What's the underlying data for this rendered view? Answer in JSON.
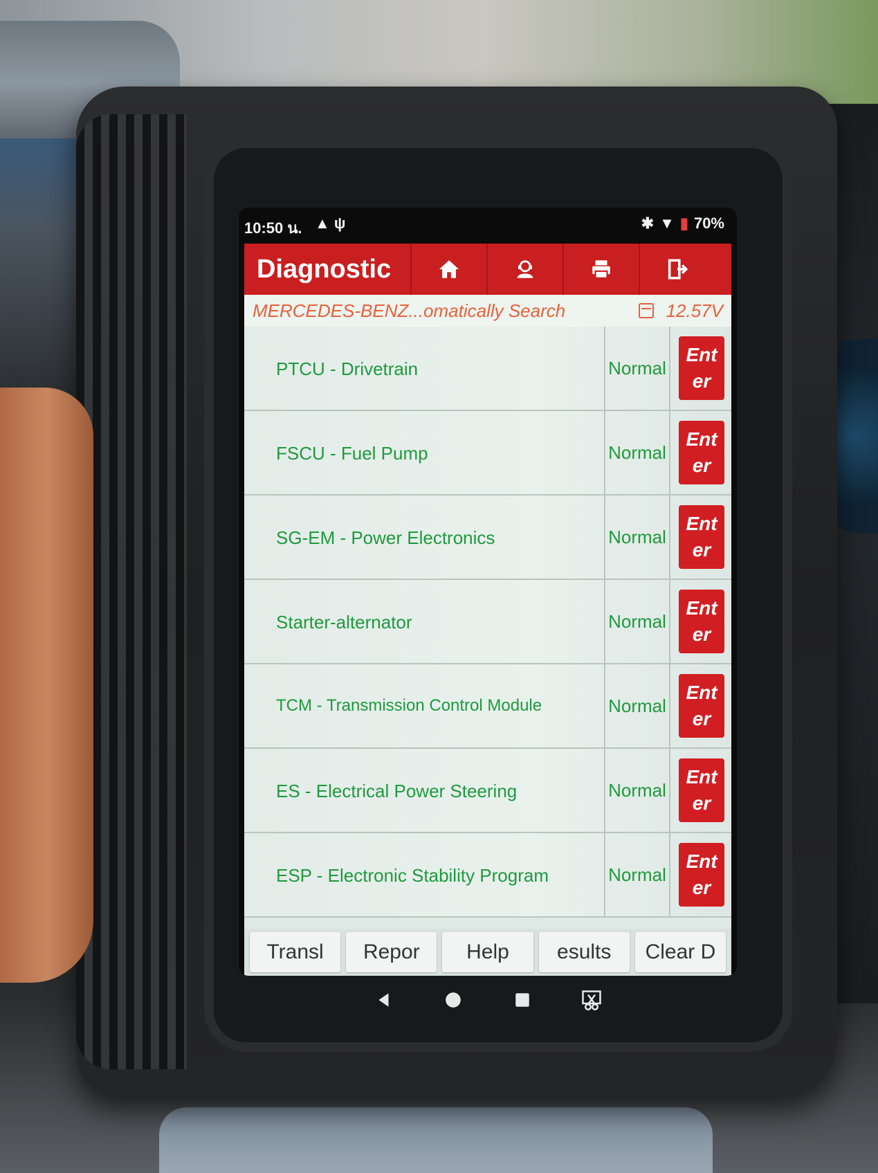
{
  "status_bar": {
    "time": "10:50 น.",
    "battery": "70%"
  },
  "app_bar": {
    "title": "Diagnostic",
    "buttons": [
      {
        "icon": "home-icon"
      },
      {
        "icon": "user-support-icon"
      },
      {
        "icon": "print-icon"
      },
      {
        "icon": "exit-icon"
      }
    ]
  },
  "sub_header": {
    "path": "MERCEDES-BENZ...omatically Search",
    "voltage": "12.57V"
  },
  "modules": [
    {
      "name": "PTCU - Drivetrain",
      "status": "Normal",
      "action": "Enter"
    },
    {
      "name": "FSCU - Fuel Pump",
      "status": "Normal",
      "action": "Enter"
    },
    {
      "name": "SG-EM - Power Electronics",
      "status": "Normal",
      "action": "Enter"
    },
    {
      "name": "Starter-alternator",
      "status": "Normal",
      "action": "Enter"
    },
    {
      "name": "TCM - Transmission Control Module",
      "status": "Normal",
      "action": "Enter"
    },
    {
      "name": "ES - Electrical Power Steering",
      "status": "Normal",
      "action": "Enter"
    },
    {
      "name": "ESP - Electronic Stability Program",
      "status": "Normal",
      "action": "Enter"
    }
  ],
  "bottom_bar": {
    "buttons": [
      "Transl",
      "Repor",
      "Help",
      "esults",
      "Clear D"
    ]
  },
  "colors": {
    "accent": "#c91f20",
    "status_text": "#1e9a3c",
    "subheader_text": "#e8613a"
  }
}
